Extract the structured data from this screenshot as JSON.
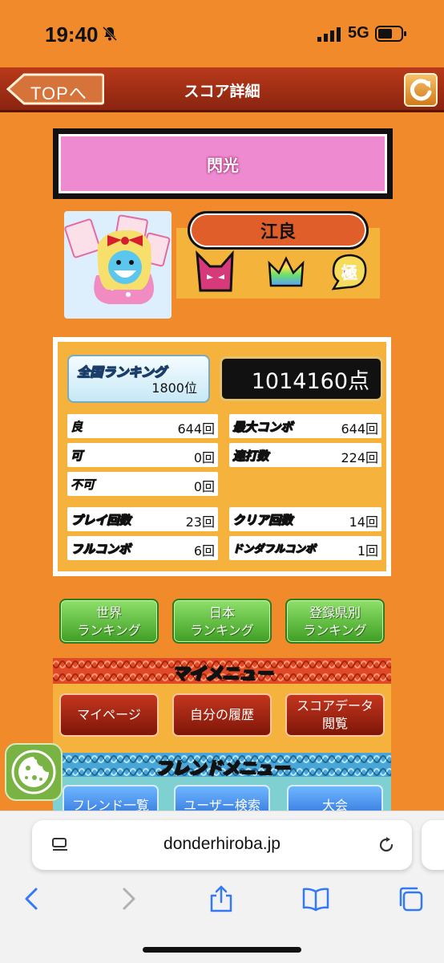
{
  "status_bar": {
    "time": "19:40",
    "network": "5G"
  },
  "header": {
    "back_label": "TOPへ",
    "title": "スコア詳細"
  },
  "song": {
    "title": "閃光"
  },
  "player": {
    "name": "江良"
  },
  "score": {
    "ranking_label": "全国ランキング",
    "ranking_value": "1800位",
    "points": "1014160点",
    "stats_left": [
      {
        "label": "良",
        "value": "644回",
        "style": "good"
      },
      {
        "label": "可",
        "value": "0回",
        "style": "ok"
      },
      {
        "label": "不可",
        "value": "0回",
        "style": "bad"
      }
    ],
    "stats_right": [
      {
        "label": "最大コンボ",
        "value": "644回"
      },
      {
        "label": "連打数",
        "value": "224回"
      }
    ],
    "play_count_label": "プレイ回数",
    "play_count": "23回",
    "clear_count_label": "クリア回数",
    "clear_count": "14回",
    "full_combo_label": "フルコンボ",
    "full_combo": "6回",
    "donda_full_label": "ドンダフルコンボ",
    "donda_full": "1回"
  },
  "ranking_buttons": [
    {
      "line1": "世界",
      "line2": "ランキング"
    },
    {
      "line1": "日本",
      "line2": "ランキング"
    },
    {
      "line1": "登録県別",
      "line2": "ランキング"
    }
  ],
  "my_menu": {
    "title": "マイメニュー",
    "items": [
      {
        "line1": "マイページ",
        "line2": ""
      },
      {
        "line1": "自分の履歴",
        "line2": ""
      },
      {
        "line1": "スコアデータ",
        "line2": "閲覧"
      }
    ]
  },
  "friend_menu": {
    "title": "フレンドメニュー",
    "items": [
      "フレンド一覧",
      "ユーザー検索",
      "大会"
    ]
  },
  "browser": {
    "url": "donderhiroba.jp"
  },
  "icons": [
    "bell-slash-icon",
    "signal-icon",
    "battery-icon",
    "back-arrow-icon",
    "reload-icon",
    "cookie-icon",
    "reader-icon",
    "refresh-icon",
    "back-icon",
    "forward-icon",
    "share-icon",
    "bookmarks-icon",
    "tabs-icon"
  ],
  "colors": {
    "background": "#f08a2a",
    "header": "#9a2a12",
    "song_box": "#ee8ad0",
    "score_panel": "#f5b23c",
    "green_button": "#4fae2e",
    "red_button": "#a0240f",
    "blue_button": "#3a86ea"
  }
}
